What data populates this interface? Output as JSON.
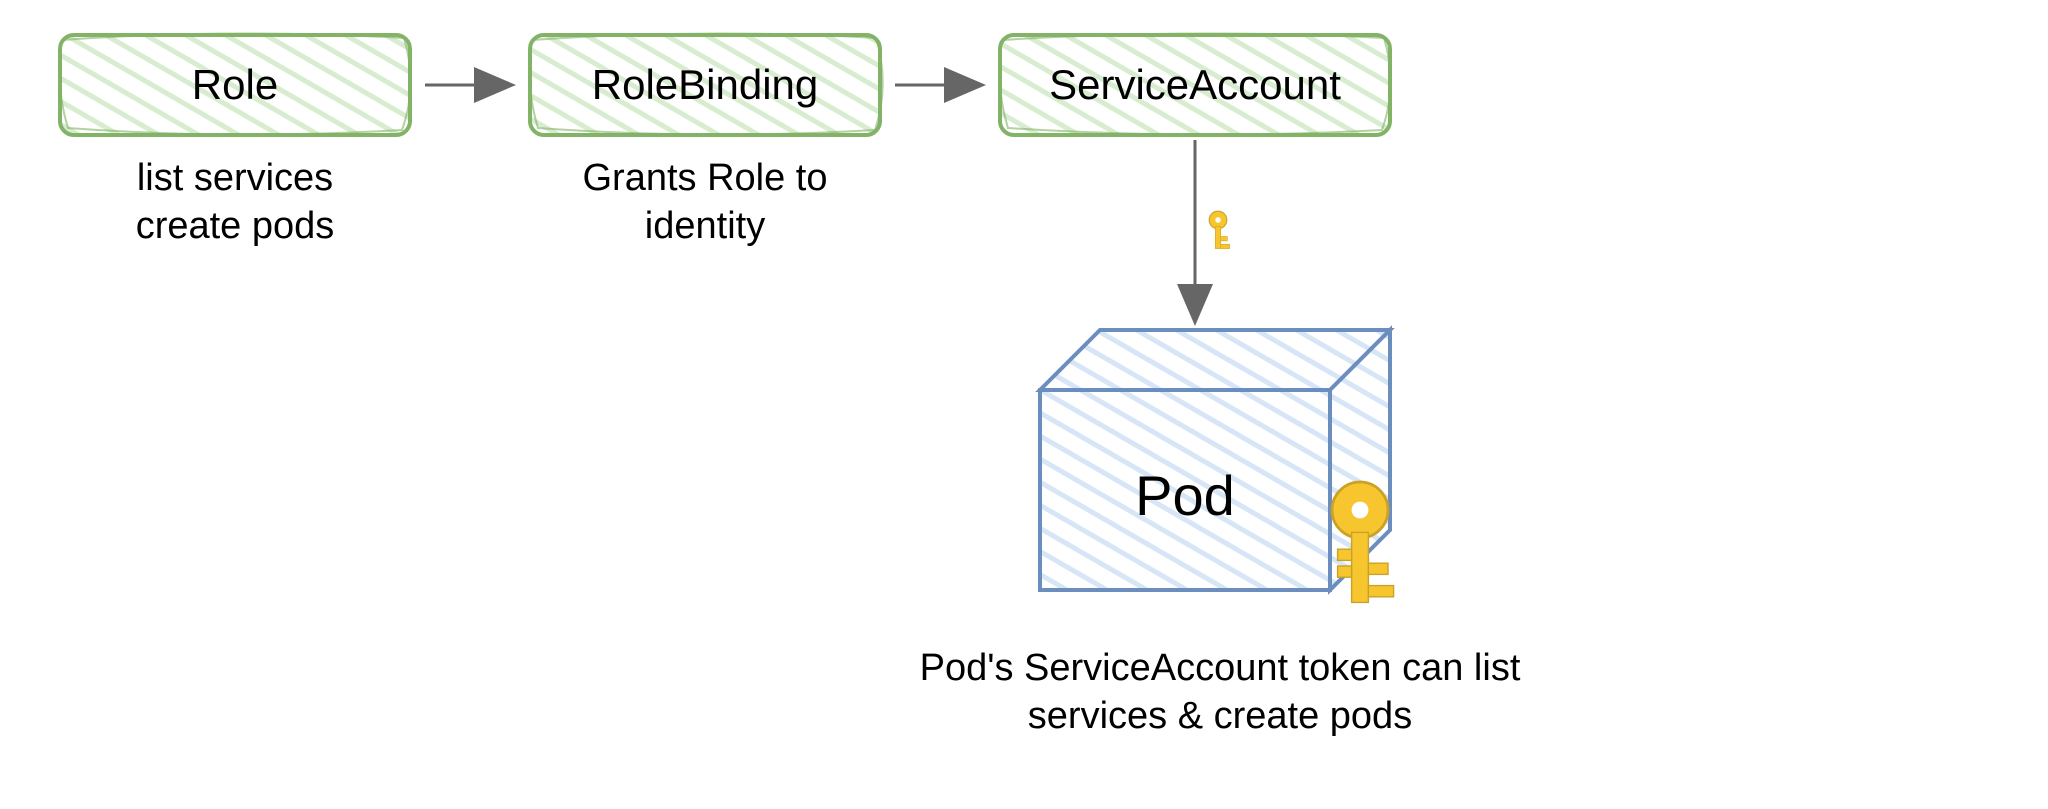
{
  "diagram": {
    "nodes": {
      "role": {
        "label": "Role",
        "caption_line1": "list services",
        "caption_line2": "create pods"
      },
      "rolebinding": {
        "label": "RoleBinding",
        "caption_line1": "Grants Role to",
        "caption_line2": "identity"
      },
      "serviceaccount": {
        "label": "ServiceAccount"
      },
      "pod": {
        "label": "Pod",
        "caption_line1": "Pod's ServiceAccount token can list",
        "caption_line2": "services & create pods"
      }
    },
    "colors": {
      "greenStroke": "#82b366",
      "greenFill": "#d5e8d4",
      "blueStroke": "#6c8ebf",
      "blueFill": "#dae8fc",
      "arrow": "#666666",
      "keyFill": "#f7c52d",
      "keyStroke": "#c9a227"
    }
  }
}
